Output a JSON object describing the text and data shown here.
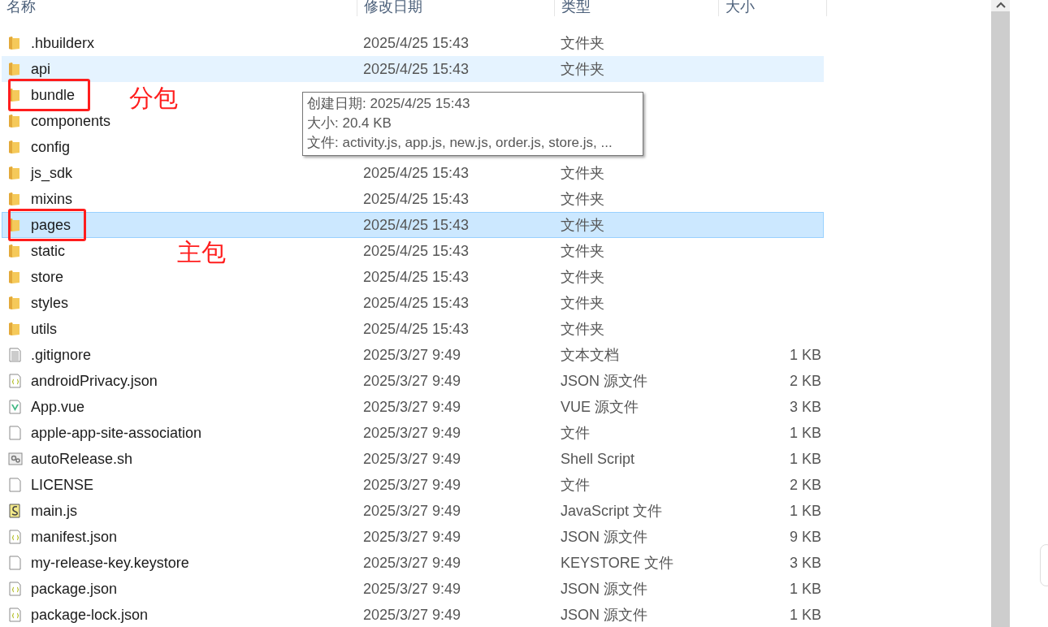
{
  "columns": [
    {
      "label": "名称"
    },
    {
      "label": "修改日期"
    },
    {
      "label": "类型"
    },
    {
      "label": "大小"
    }
  ],
  "rows": [
    {
      "name": ".hbuilderx",
      "date": "2025/4/25 15:43",
      "type": "文件夹",
      "kind": "folder",
      "selected": false,
      "hovered": false
    },
    {
      "name": "api",
      "date": "2025/4/25 15:43",
      "type": "文件夹",
      "kind": "folder",
      "selected": false,
      "hovered": true
    },
    {
      "name": "bundle",
      "kind": "folder",
      "selected": false,
      "hovered": false,
      "annotation": "分包"
    },
    {
      "name": "components",
      "kind": "folder",
      "selected": false,
      "hovered": false
    },
    {
      "name": "config",
      "kind": "folder",
      "selected": false,
      "hovered": false
    },
    {
      "name": "js_sdk",
      "date": "2025/4/25 15:43",
      "type": "文件夹",
      "kind": "folder",
      "selected": false,
      "hovered": false
    },
    {
      "name": "mixins",
      "date": "2025/4/25 15:43",
      "type": "文件夹",
      "kind": "folder",
      "selected": false,
      "hovered": false
    },
    {
      "name": "pages",
      "date": "2025/4/25 15:43",
      "type": "文件夹",
      "kind": "folder",
      "selected": true,
      "hovered": false,
      "annotation": "主包"
    },
    {
      "name": "static",
      "date": "2025/4/25 15:43",
      "type": "文件夹",
      "kind": "folder",
      "selected": false,
      "hovered": false
    },
    {
      "name": "store",
      "date": "2025/4/25 15:43",
      "type": "文件夹",
      "kind": "folder",
      "selected": false,
      "hovered": false
    },
    {
      "name": "styles",
      "date": "2025/4/25 15:43",
      "type": "文件夹",
      "kind": "folder",
      "selected": false,
      "hovered": false
    },
    {
      "name": "utils",
      "date": "2025/4/25 15:43",
      "type": "文件夹",
      "kind": "folder",
      "selected": false,
      "hovered": false
    },
    {
      "name": ".gitignore",
      "date": "2025/3/27 9:49",
      "type": "文本文档",
      "size": "1 KB",
      "kind": "text",
      "selected": false,
      "hovered": false
    },
    {
      "name": "androidPrivacy.json",
      "date": "2025/3/27 9:49",
      "type": "JSON 源文件",
      "size": "2 KB",
      "kind": "json",
      "selected": false,
      "hovered": false
    },
    {
      "name": "App.vue",
      "date": "2025/3/27 9:49",
      "type": "VUE 源文件",
      "size": "3 KB",
      "kind": "vue",
      "selected": false,
      "hovered": false
    },
    {
      "name": "apple-app-site-association",
      "date": "2025/3/27 9:49",
      "type": "文件",
      "size": "1 KB",
      "kind": "blank",
      "selected": false,
      "hovered": false
    },
    {
      "name": "autoRelease.sh",
      "date": "2025/3/27 9:49",
      "type": "Shell Script",
      "size": "1 KB",
      "kind": "script",
      "selected": false,
      "hovered": false
    },
    {
      "name": "LICENSE",
      "date": "2025/3/27 9:49",
      "type": "文件",
      "size": "2 KB",
      "kind": "blank",
      "selected": false,
      "hovered": false
    },
    {
      "name": "main.js",
      "date": "2025/3/27 9:49",
      "type": "JavaScript 文件",
      "size": "1 KB",
      "kind": "js",
      "selected": false,
      "hovered": false
    },
    {
      "name": "manifest.json",
      "date": "2025/3/27 9:49",
      "type": "JSON 源文件",
      "size": "9 KB",
      "kind": "json",
      "selected": false,
      "hovered": false
    },
    {
      "name": "my-release-key.keystore",
      "date": "2025/3/27 9:49",
      "type": "KEYSTORE 文件",
      "size": "3 KB",
      "kind": "blank",
      "selected": false,
      "hovered": false
    },
    {
      "name": "package.json",
      "date": "2025/3/27 9:49",
      "type": "JSON 源文件",
      "size": "1 KB",
      "kind": "json",
      "selected": false,
      "hovered": false
    },
    {
      "name": "package-lock.json",
      "date": "2025/3/27 9:49",
      "type": "JSON 源文件",
      "size": "1 KB",
      "kind": "json",
      "selected": false,
      "hovered": false
    }
  ],
  "tooltip": [
    "创建日期: 2025/4/25 15:43",
    "大小: 20.4 KB",
    "文件: activity.js, app.js, new.js, order.js, store.js, ..."
  ]
}
